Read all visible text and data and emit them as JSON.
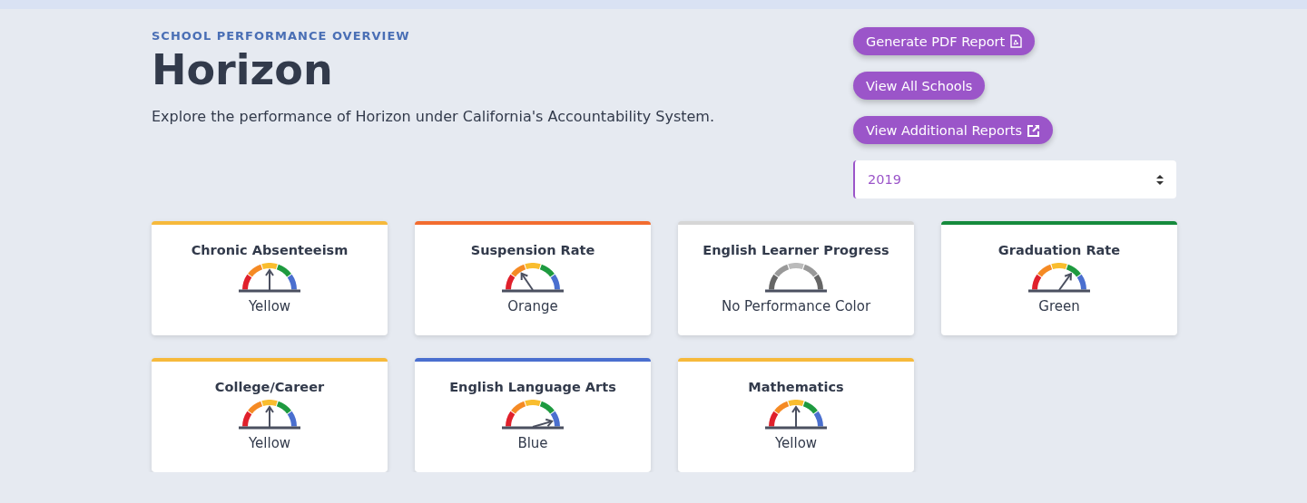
{
  "header": {
    "eyebrow": "SCHOOL PERFORMANCE OVERVIEW",
    "title": "Horizon",
    "description": "Explore the performance of Horizon under California's Accountability System."
  },
  "actions": [
    {
      "label": "Generate PDF Report"
    },
    {
      "label": "View All Schools"
    },
    {
      "label": "View Additional Reports"
    }
  ],
  "year_select": {
    "value": "2019"
  },
  "indicators": [
    {
      "title": "Chronic Absenteeism",
      "status": "Yellow",
      "color": "#f6b93b",
      "kind": "yellow"
    },
    {
      "title": "Suspension Rate",
      "status": "Orange",
      "color": "#f26c2f",
      "kind": "orange"
    },
    {
      "title": "English Learner Progress",
      "status": "No Performance Color",
      "color": "#d6d6d6",
      "kind": "grey"
    },
    {
      "title": "Graduation Rate",
      "status": "Green",
      "color": "#158a3c",
      "kind": "green"
    },
    {
      "title": "College/Career",
      "status": "Yellow",
      "color": "#f6b93b",
      "kind": "yellow"
    },
    {
      "title": "English Language Arts",
      "status": "Blue",
      "color": "#4a6fcf",
      "kind": "blue"
    },
    {
      "title": "Mathematics",
      "status": "Yellow",
      "color": "#f6b93b",
      "kind": "yellow"
    }
  ]
}
